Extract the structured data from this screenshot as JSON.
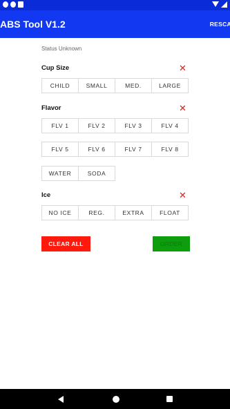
{
  "app": {
    "title": "ABS Tool V1.2",
    "rescan_label": "RESCA"
  },
  "status_text": "Status Unknown",
  "sections": {
    "cup_size": {
      "title": "Cup Size",
      "clear_icon": "✕",
      "options": [
        "CHILD",
        "SMALL",
        "MED.",
        "LARGE"
      ]
    },
    "flavor": {
      "title": "Flavor",
      "clear_icon": "✕",
      "row1": [
        "FLV 1",
        "FLV 2",
        "FLV 3",
        "FLV 4"
      ],
      "row2": [
        "FLV 5",
        "FLV 6",
        "FLV 7",
        "FLV 8"
      ],
      "row3": [
        "WATER",
        "SODA"
      ]
    },
    "ice": {
      "title": "Ice",
      "clear_icon": "✕",
      "options": [
        "NO ICE",
        "REG.",
        "EXTRA",
        "FLOAT"
      ]
    }
  },
  "actions": {
    "clear_all": "CLEAR ALL",
    "order": "ORDER"
  },
  "colors": {
    "app_bar": "#1238f2",
    "status_bar": "#0a2bd8",
    "clear_all": "#ff1a0d",
    "order": "#0d9d0d",
    "close_icon": "#e31b1b"
  },
  "icons": {
    "status_left": [
      "notification-icon",
      "app-icon",
      "sd-card-icon"
    ],
    "status_right": [
      "wifi-icon",
      "signal-icon"
    ],
    "nav": [
      "back-icon",
      "home-icon",
      "recents-icon"
    ]
  }
}
